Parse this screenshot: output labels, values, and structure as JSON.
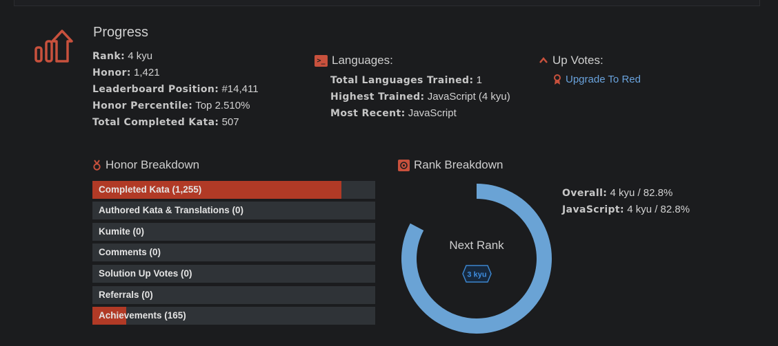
{
  "progress": {
    "title": "Progress",
    "stats": [
      {
        "label": "Rank:",
        "value": "4 kyu"
      },
      {
        "label": "Honor:",
        "value": "1,421"
      },
      {
        "label": "Leaderboard Position:",
        "value": "#14,411"
      },
      {
        "label": "Honor Percentile:",
        "value": "Top 2.510%"
      },
      {
        "label": "Total Completed Kata:",
        "value": "507"
      }
    ]
  },
  "languages": {
    "title": "Languages:",
    "icon": "terminal-icon",
    "stats": [
      {
        "label": "Total Languages Trained:",
        "value": "1"
      },
      {
        "label": "Highest Trained:",
        "value": "JavaScript (4 kyu)"
      },
      {
        "label": "Most Recent:",
        "value": "JavaScript"
      }
    ]
  },
  "upvotes": {
    "title": "Up Votes:",
    "link": "Upgrade To Red"
  },
  "honor_breakdown": {
    "title": "Honor Breakdown",
    "items": [
      {
        "label": "Completed Kata (1,255)",
        "fraction": 0.88
      },
      {
        "label": "Authored Kata & Translations (0)",
        "fraction": 0
      },
      {
        "label": "Kumite (0)",
        "fraction": 0
      },
      {
        "label": "Comments (0)",
        "fraction": 0
      },
      {
        "label": "Solution Up Votes (0)",
        "fraction": 0
      },
      {
        "label": "Referrals (0)",
        "fraction": 0
      },
      {
        "label": "Achievements (165)",
        "fraction": 0.12
      }
    ]
  },
  "rank_breakdown": {
    "title": "Rank Breakdown",
    "next_rank_label": "Next Rank",
    "next_rank": "3 kyu",
    "progress_percent": 82.8,
    "stats": [
      {
        "label": "Overall:",
        "value": "4 kyu / 82.8%"
      },
      {
        "label": "JavaScript:",
        "value": "4 kyu / 82.8%"
      }
    ]
  },
  "colors": {
    "accent": "#c8513d",
    "bar_fill": "#b13a26",
    "bar_bg": "#2f3337",
    "donut": "#6aa3d5",
    "link": "#6aa3dd"
  }
}
